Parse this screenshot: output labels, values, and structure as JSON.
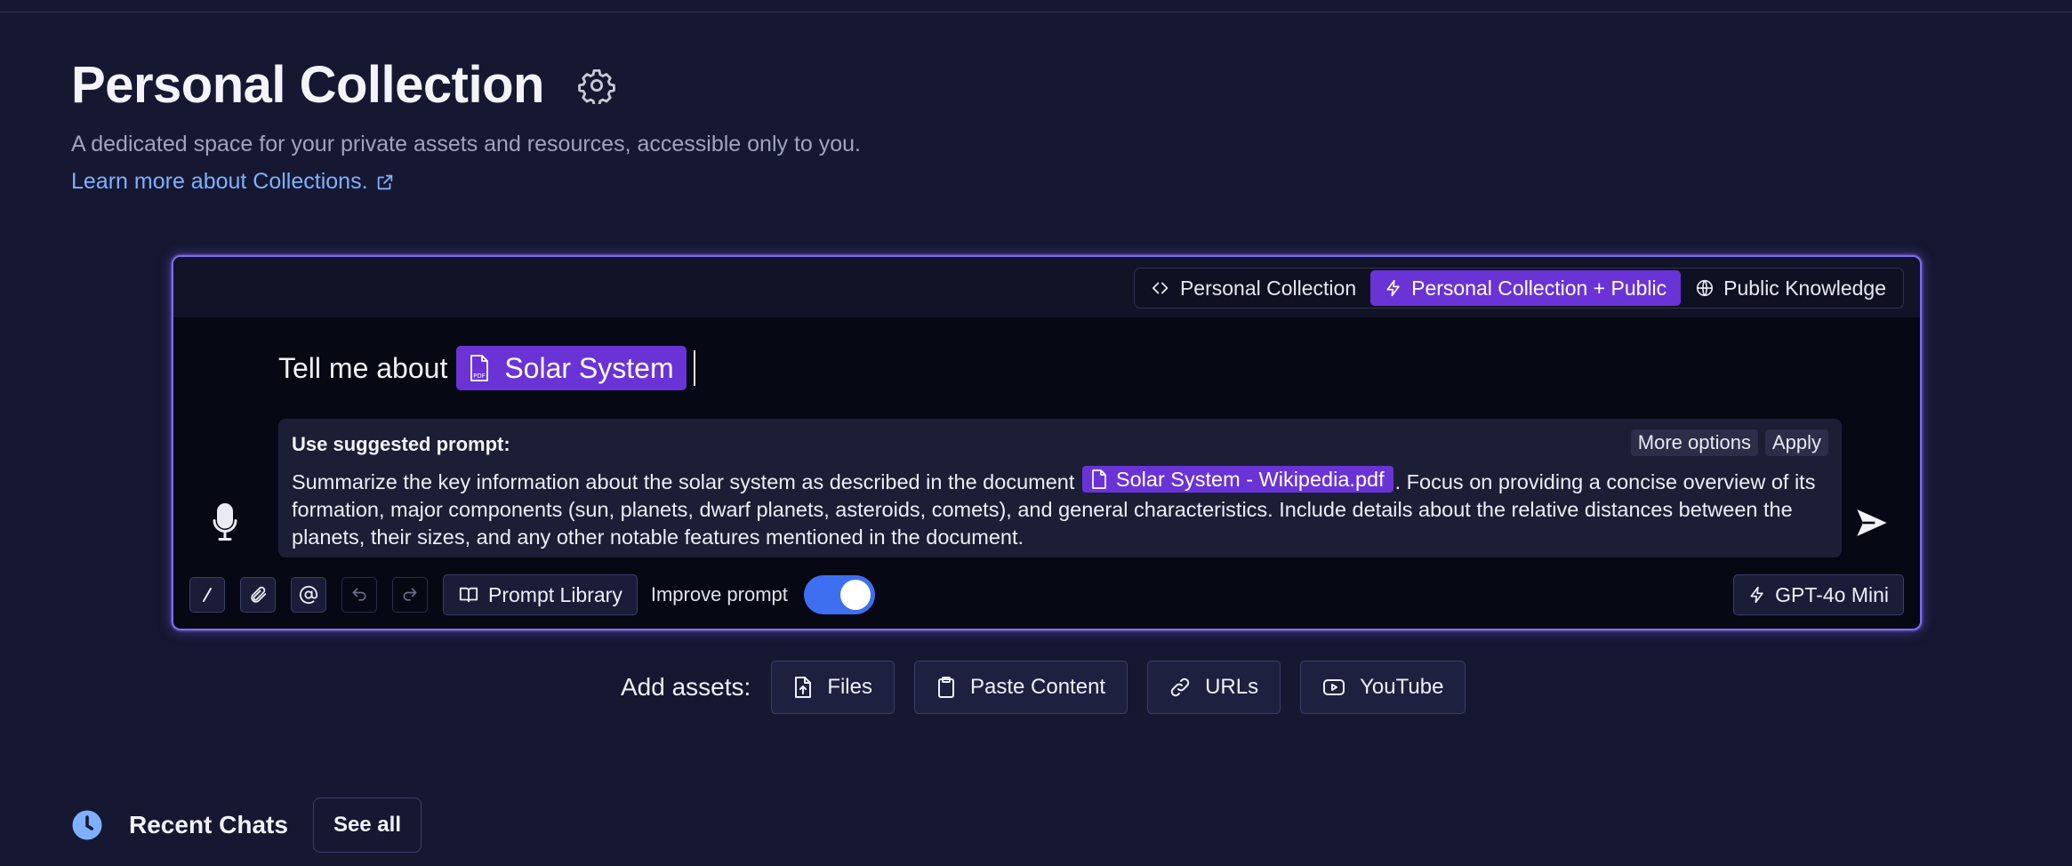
{
  "header": {
    "title": "Personal Collection",
    "subtitle": "A dedicated space for your private assets and resources, accessible only to you.",
    "learn_more": "Learn more about Collections."
  },
  "scope": {
    "options": [
      "Personal Collection",
      "Personal Collection + Public",
      "Public Knowledge"
    ],
    "selected": "Personal Collection + Public"
  },
  "prompt": {
    "prefix": "Tell me about",
    "chip_label": "Solar System",
    "chip_icon_text": "PDF"
  },
  "suggestion": {
    "label": "Use suggested prompt:",
    "more_options": "More options",
    "apply": "Apply",
    "text_before": "Summarize the key information about the solar system as described in the document",
    "chip_label": "Solar System - Wikipedia.pdf",
    "text_after": ". Focus on providing a concise overview of its formation, major components (sun, planets, dwarf planets, asteroids, comets), and general characteristics. Include details about the relative distances between the planets, their sizes, and any other notable features mentioned in the document."
  },
  "toolbar": {
    "prompt_library": "Prompt Library",
    "improve_prompt": "Improve prompt",
    "improve_enabled": true,
    "model": "GPT-4o Mini"
  },
  "assets": {
    "label": "Add assets:",
    "buttons": [
      "Files",
      "Paste Content",
      "URLs",
      "YouTube"
    ]
  },
  "recent": {
    "title": "Recent Chats",
    "see_all": "See all"
  },
  "colors": {
    "background": "#161831",
    "accent_purple": "#6a33d6",
    "toggle_blue": "#3e6ff0",
    "link_blue": "#7fb0ff"
  }
}
